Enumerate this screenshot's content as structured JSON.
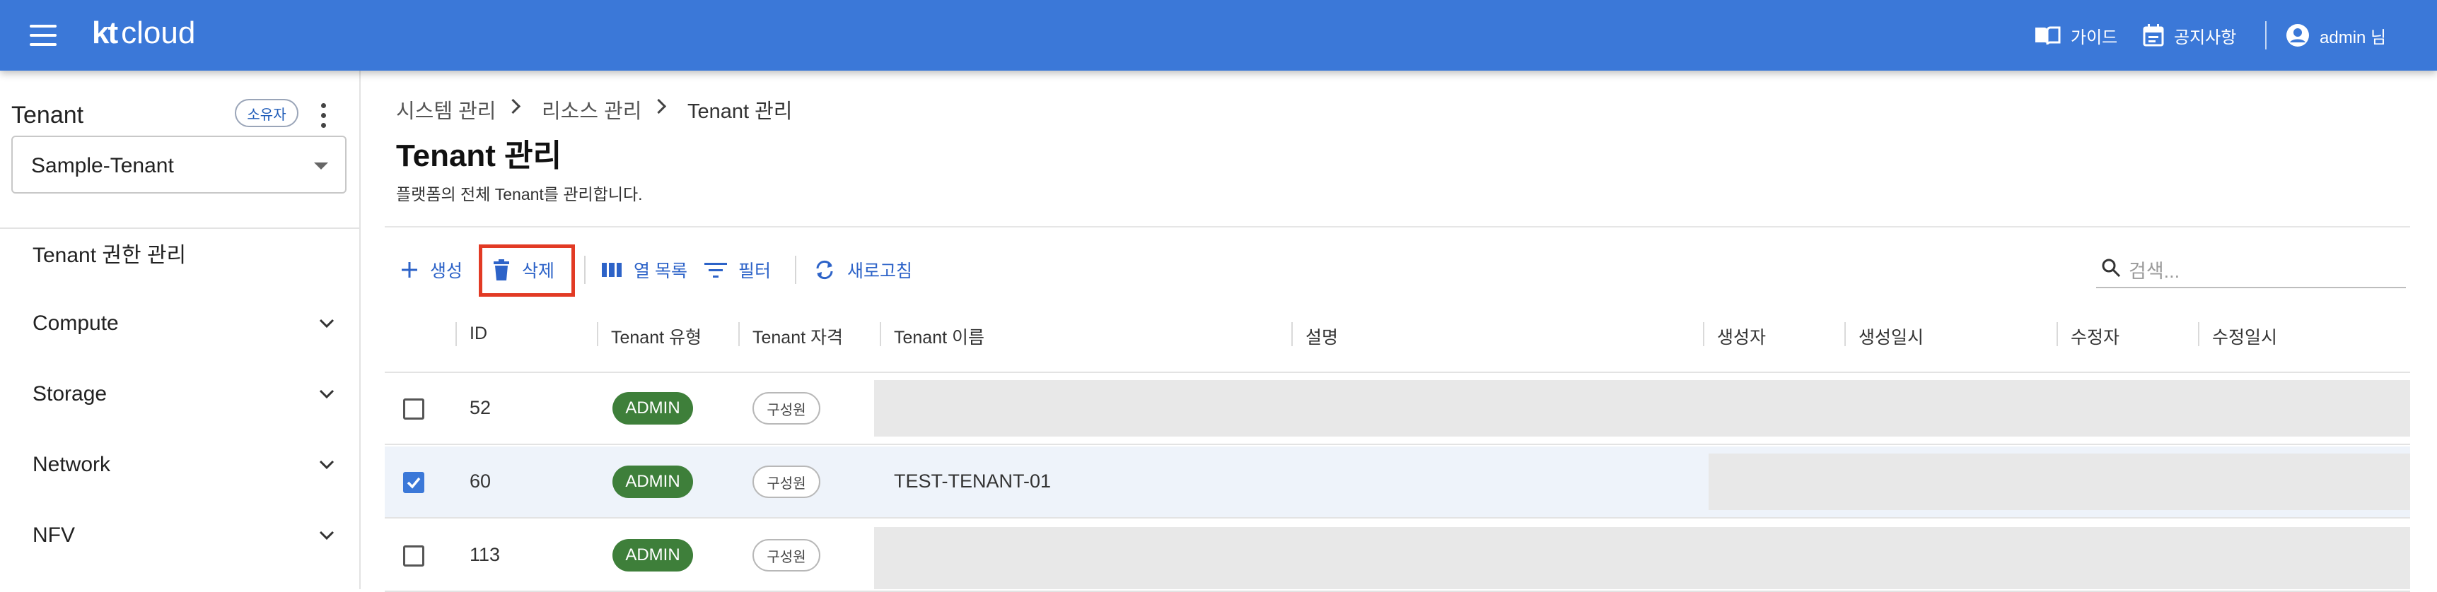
{
  "header": {
    "logo_bold": "kt",
    "logo_rest": "cloud",
    "guide_label": "가이드",
    "notice_label": "공지사항",
    "user_label": "admin 님"
  },
  "sidebar": {
    "title": "Tenant",
    "owner_badge": "소유자",
    "selected_tenant": "Sample-Tenant",
    "items": [
      {
        "label": "Tenant 권한 관리"
      },
      {
        "label": "Compute"
      },
      {
        "label": "Storage"
      },
      {
        "label": "Network"
      },
      {
        "label": "NFV"
      }
    ]
  },
  "breadcrumb": [
    "시스템 관리",
    "리소스 관리",
    "Tenant 관리"
  ],
  "page": {
    "title": "Tenant 관리",
    "description": "플랫폼의 전체 Tenant를 관리합니다."
  },
  "toolbar": {
    "create_label": "생성",
    "delete_label": "삭제",
    "columns_label": "열 목록",
    "filter_label": "필터",
    "refresh_label": "새로고침",
    "search_placeholder": "검색..."
  },
  "table": {
    "columns": [
      "ID",
      "Tenant 유형",
      "Tenant 자격",
      "Tenant 이름",
      "설명",
      "생성자",
      "생성일시",
      "수정자",
      "수정일시"
    ],
    "rows": [
      {
        "id": "52",
        "type": "ADMIN",
        "role": "구성원",
        "name": "",
        "checked": false
      },
      {
        "id": "60",
        "type": "ADMIN",
        "role": "구성원",
        "name": "TEST-TENANT-01",
        "checked": true
      },
      {
        "id": "113",
        "type": "ADMIN",
        "role": "구성원",
        "name": "",
        "checked": false
      }
    ]
  },
  "colors": {
    "header_bg": "#3b78d8",
    "accent": "#2d63c8",
    "admin_chip": "#3e7f3a",
    "highlight_box": "#e23a24"
  }
}
